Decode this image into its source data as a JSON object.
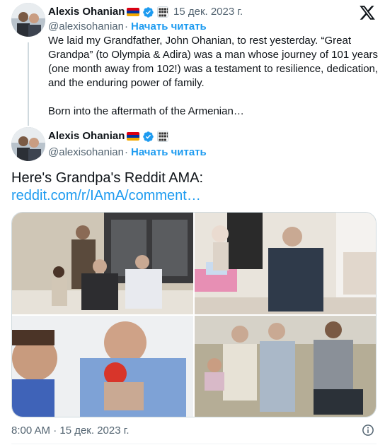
{
  "thread_tweet": {
    "author_name": "Alexis Ohanian",
    "date": "15 дек. 2023 г.",
    "handle": "@alexisohanian",
    "separator": "·",
    "follow_label": "Начать читать",
    "paragraph_1": "We laid my Grandfather, John Ohanian, to rest yesterday. “Great Grandpa” (to Olympia & Adira) was a man whose journey of 101 years (one month away from 102!) was a testament to resilience, dedication, and the enduring power of family.",
    "paragraph_2": "Born into the aftermath of the Armenian…",
    "affiliation_badge": "Seven Seven Six"
  },
  "main_tweet": {
    "author_name": "Alexis Ohanian",
    "handle": "@alexisohanian",
    "separator": "·",
    "follow_label": "Начать читать",
    "affiliation_badge": "Seven Seven Six",
    "text": "Here's Grandpa's Reddit AMA:",
    "link": "reddit.com/r/IAmA/comment…",
    "timestamp": "8:00 AM · 15 дек. 2023 г."
  },
  "icons": {
    "platform_logo": "x-logo-icon",
    "verified": "verified-badge-icon",
    "flag": "armenia-flag-icon",
    "info": "info-icon"
  },
  "colors": {
    "accent": "#1d9bf0",
    "text": "#0f1419",
    "muted": "#536471",
    "flag_red": "#d90012",
    "flag_blue": "#0033a0",
    "flag_orange": "#f2a800"
  }
}
